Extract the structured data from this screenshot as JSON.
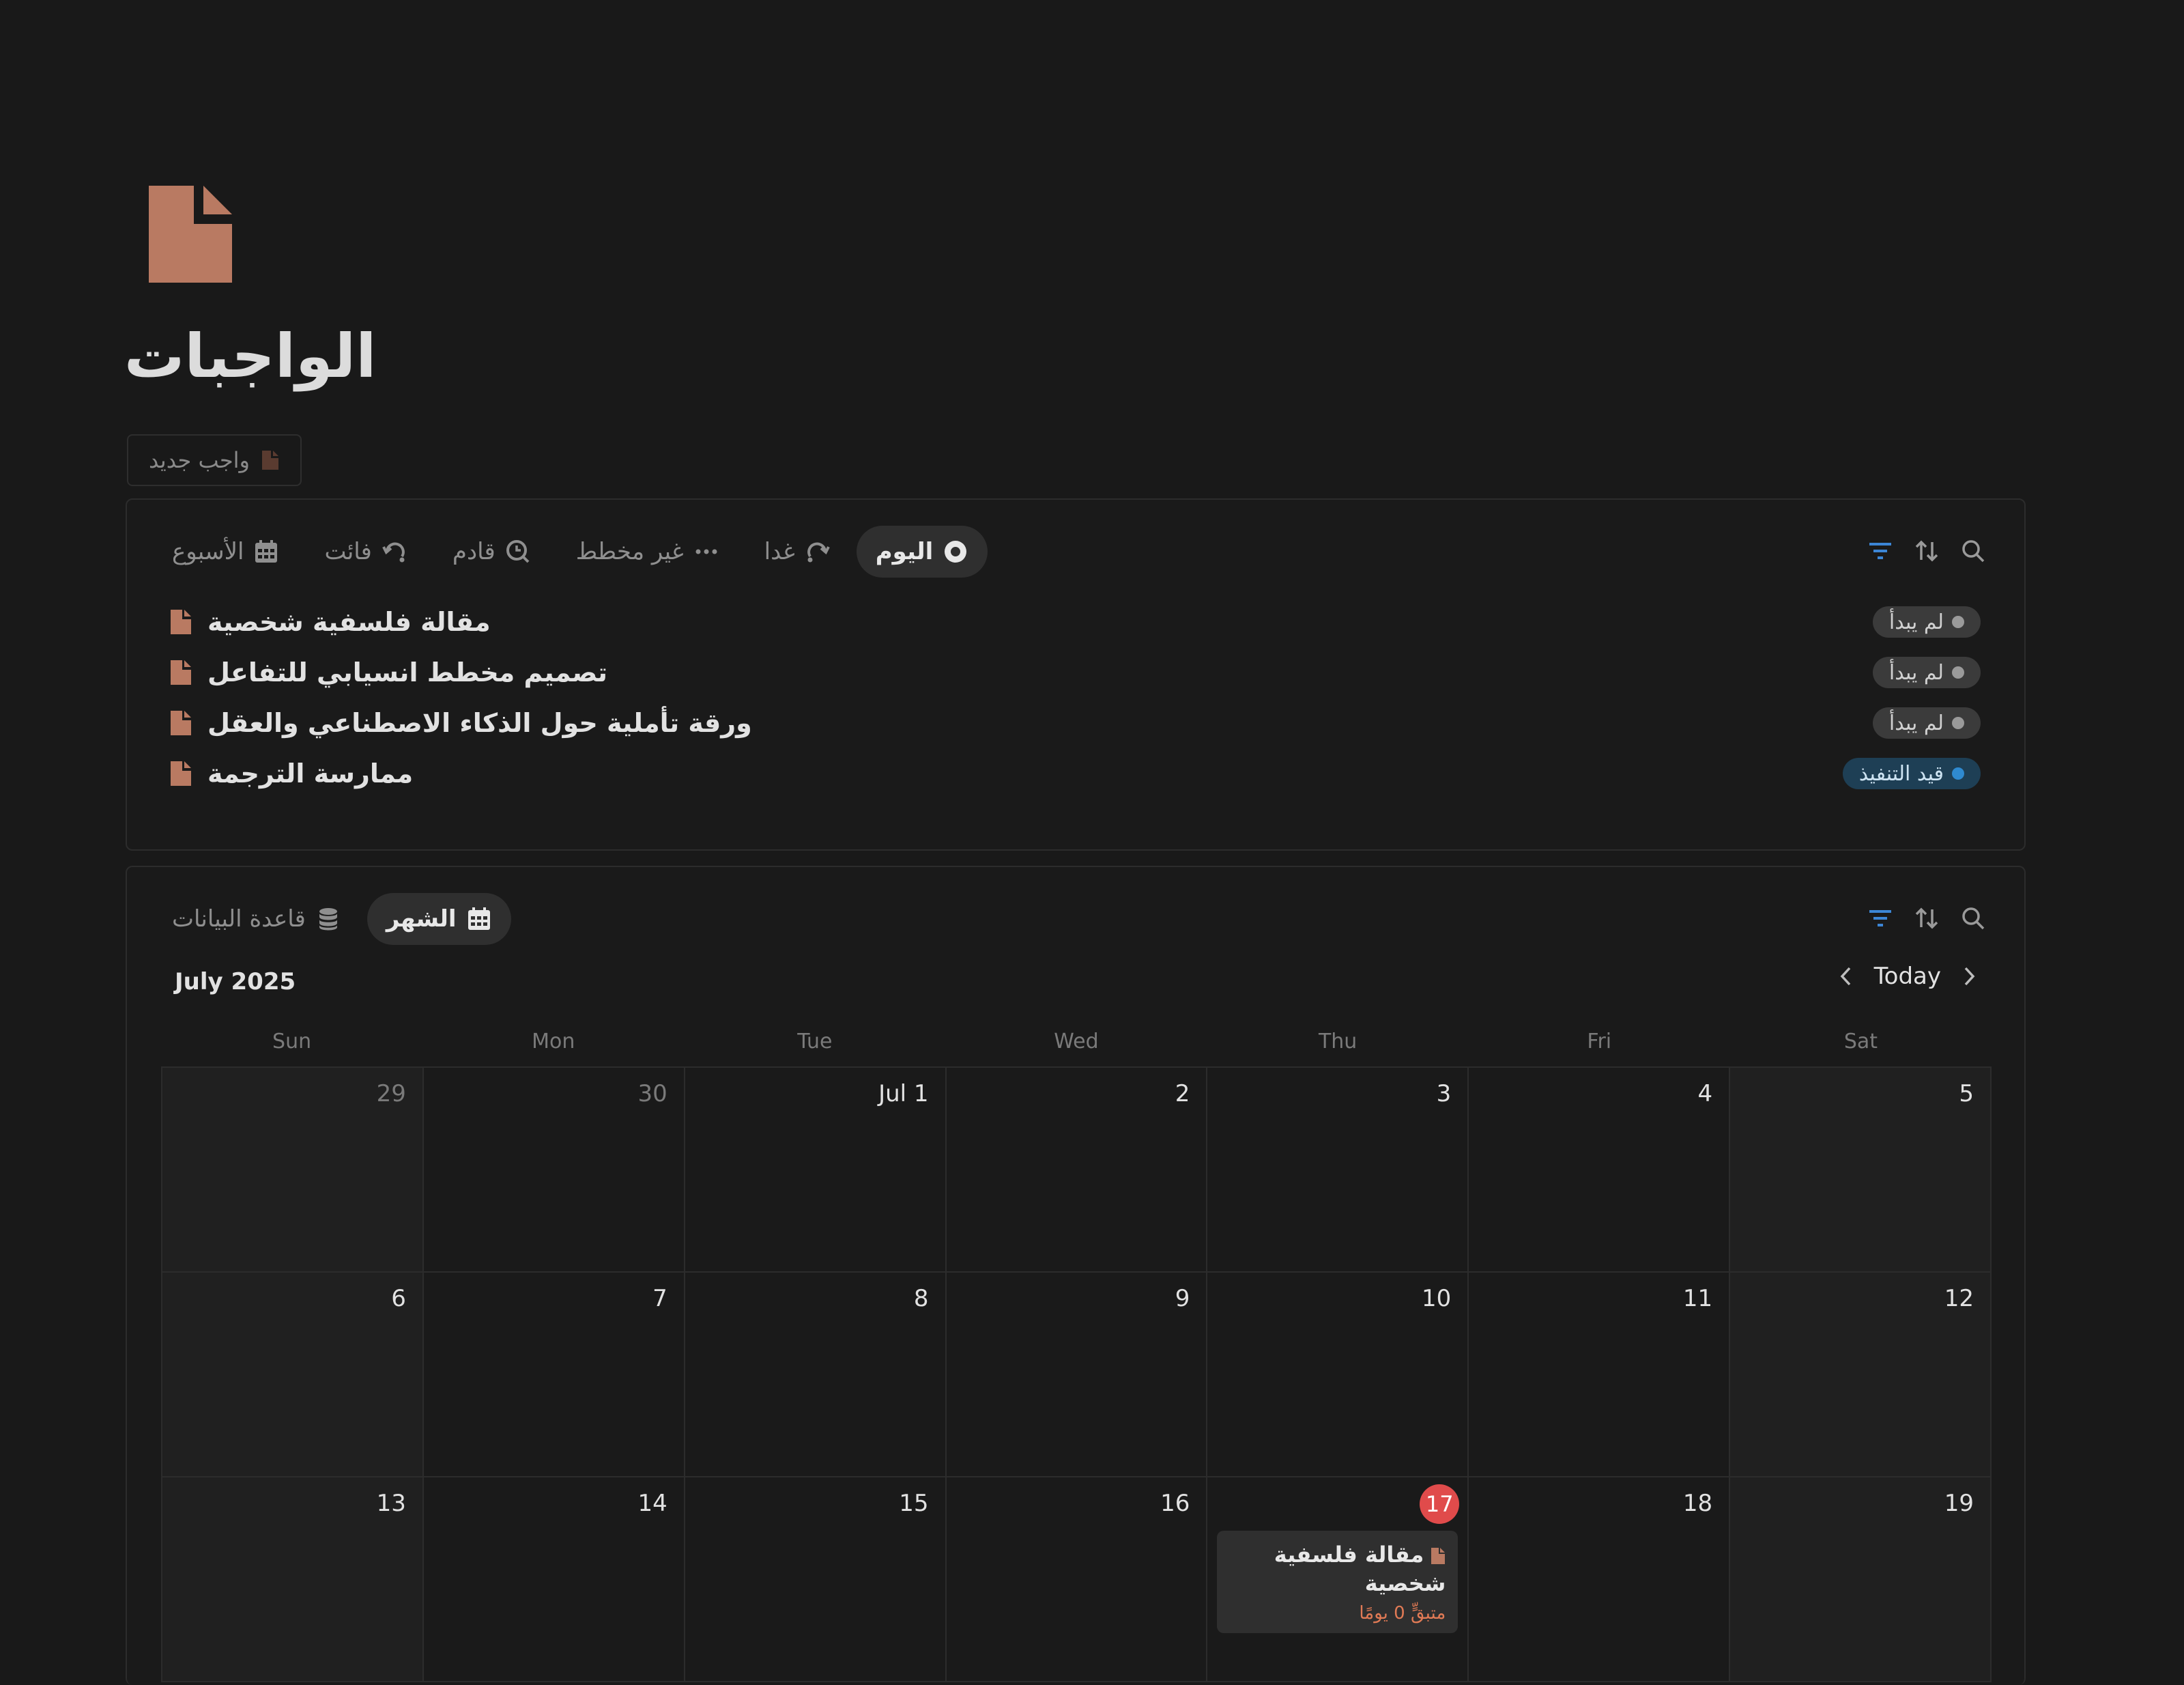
{
  "page": {
    "title": "الواجبات",
    "new_button_label": "واجب جديد",
    "icon": "document-icon",
    "accent_color": "#c0806a"
  },
  "list_view": {
    "tabs": [
      {
        "label": "اليوم",
        "icon": "radio-icon",
        "active": true
      },
      {
        "label": "غدا",
        "icon": "redo-arrow-icon"
      },
      {
        "label": "غير مخطط",
        "icon": "ellipsis-icon"
      },
      {
        "label": "قادم",
        "icon": "search-clock-icon"
      },
      {
        "label": "فائت",
        "icon": "undo-arrow-icon"
      },
      {
        "label": "الأسبوع",
        "icon": "calendar-icon"
      }
    ],
    "tools": [
      "filter-icon",
      "sort-icon",
      "search-icon"
    ],
    "items": [
      {
        "name": "مقالة فلسفية شخصية",
        "status": "لم يبدأ",
        "status_type": "notstarted"
      },
      {
        "name": "تصميم مخطط انسيابي للتفاعل",
        "status": "لم يبدأ",
        "status_type": "notstarted"
      },
      {
        "name": "ورقة تأملية حول الذكاء الاصطناعي والعقل",
        "status": "لم يبدأ",
        "status_type": "notstarted"
      },
      {
        "name": "ممارسة الترجمة",
        "status": "قيد التنفيذ",
        "status_type": "inprogress"
      }
    ]
  },
  "calendar_view": {
    "tabs": [
      {
        "label": "الشهر",
        "icon": "calendar-icon",
        "active": true
      },
      {
        "label": "قاعدة البيانات",
        "icon": "database-icon"
      }
    ],
    "month_label": "July 2025",
    "today_label": "Today",
    "weekdays": [
      "Sun",
      "Mon",
      "Tue",
      "Wed",
      "Thu",
      "Fri",
      "Sat"
    ],
    "weeks": [
      [
        "29",
        "30",
        "Jul 1",
        "2",
        "3",
        "4",
        "5"
      ],
      [
        "6",
        "7",
        "8",
        "9",
        "10",
        "11",
        "12"
      ],
      [
        "13",
        "14",
        "15",
        "16",
        "17",
        "18",
        "19"
      ]
    ],
    "muted_days": [
      "29",
      "30"
    ],
    "today": "17",
    "event": {
      "day": "17",
      "title": "مقالة فلسفية شخصية",
      "due_text": "متبقٍّ 0 يومًا"
    }
  }
}
